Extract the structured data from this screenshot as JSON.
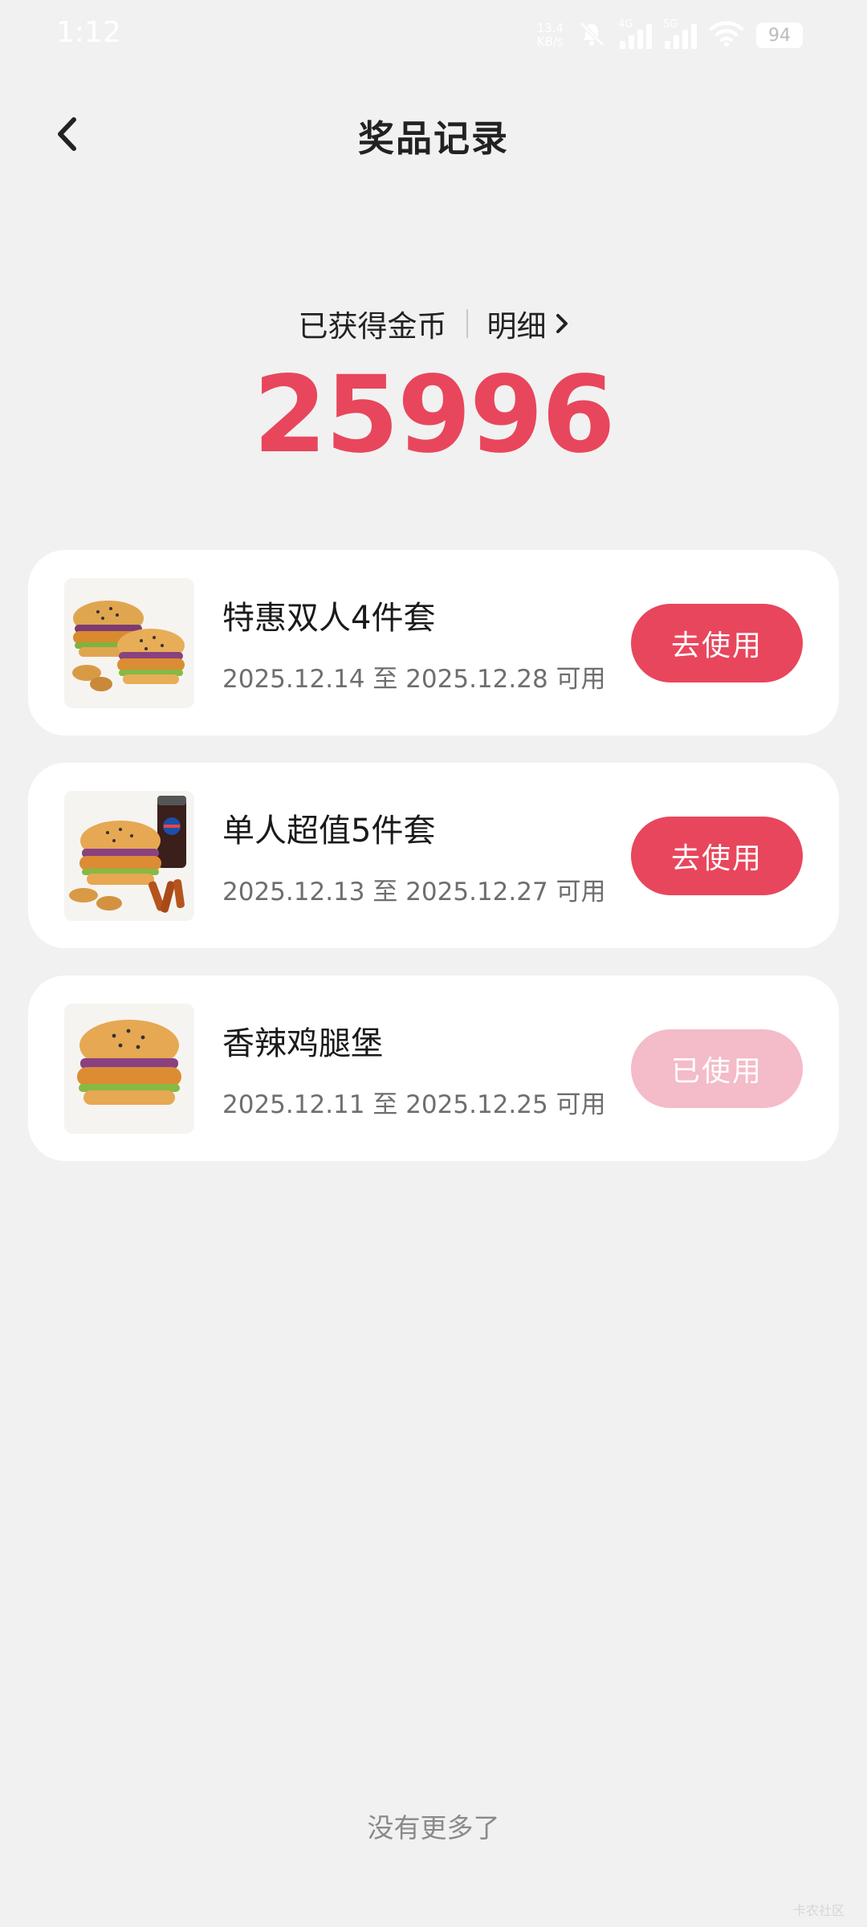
{
  "status_bar": {
    "time": "1:12",
    "net_speed_value": "13.4",
    "net_speed_unit": "KB/s",
    "sim1_label": "4G",
    "sim2_label": "5G",
    "battery": "94"
  },
  "header": {
    "title": "奖品记录"
  },
  "coins": {
    "label": "已获得金币",
    "detail_link": "明细",
    "value": "25996"
  },
  "colors": {
    "accent": "#e8465c",
    "accent_disabled": "#f4bbc8",
    "background": "#f1f1f1"
  },
  "items": [
    {
      "name": "特惠双人4件套",
      "date": "2025.12.14 至 2025.12.28 可用",
      "button": "去使用",
      "state": "active",
      "image": "two-burger-combo"
    },
    {
      "name": "单人超值5件套",
      "date": "2025.12.13 至 2025.12.27 可用",
      "button": "去使用",
      "state": "active",
      "image": "burger-cola-combo"
    },
    {
      "name": "香辣鸡腿堡",
      "date": "2025.12.11 至 2025.12.25 可用",
      "button": "已使用",
      "state": "used",
      "image": "single-burger"
    }
  ],
  "footer": {
    "no_more": "没有更多了",
    "watermark": "卡农社区"
  }
}
